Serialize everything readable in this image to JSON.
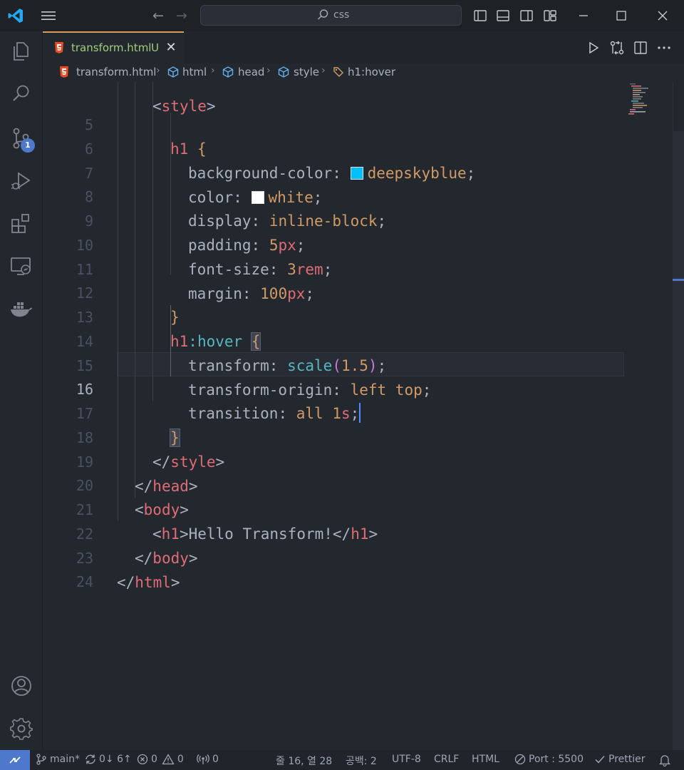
{
  "titlebar": {
    "search_text": "css",
    "nav_back": "←",
    "nav_forward": "→"
  },
  "activity": {
    "scm_badge": "1"
  },
  "tab": {
    "filename": "transform.html",
    "status": "U",
    "close": "✕"
  },
  "breadcrumb": {
    "file": "transform.html",
    "items": [
      "html",
      "head",
      "style",
      "h1:hover"
    ]
  },
  "editor": {
    "line_numbers": [
      "5",
      "6",
      "7",
      "8",
      "9",
      "10",
      "11",
      "12",
      "13",
      "14",
      "15",
      "16",
      "17",
      "18",
      "19",
      "20",
      "21",
      "22",
      "23",
      "24"
    ],
    "active_line": "16",
    "lines": {
      "l5_sel": "h1",
      "l5_brace": "{",
      "l6_prop": "background-color",
      "l6_val": "deepskyblue",
      "l7_prop": "color",
      "l7_val": "white",
      "l8_prop": "display",
      "l8_val": "inline-block",
      "l9_prop": "padding",
      "l9_num": "5",
      "l9_unit": "px",
      "l10_prop": "font-size",
      "l10_num": "3",
      "l10_unit": "rem",
      "l11_prop": "margin",
      "l11_num": "100",
      "l11_unit": "px",
      "l12_brace": "}",
      "l13_sel": "h1",
      "l13_pseudo": ":hover",
      "l13_brace": "{",
      "l14_prop": "transform",
      "l14_fn": "scale",
      "l14_num": "1.5",
      "l15_prop": "transform-origin",
      "l15_val": "left top",
      "l16_prop": "transition",
      "l16_val": "all",
      "l16_num": "1",
      "l16_unit": "s",
      "l17_brace": "}",
      "l18_tag": "style",
      "l19_tag": "head",
      "l20_tag": "body",
      "l21_tag": "h1",
      "l21_text": "Hello Transform!",
      "l22_tag": "body",
      "l23_tag": "html"
    },
    "swatch_colors": {
      "deepskyblue": "#00bfff",
      "white": "#ffffff"
    }
  },
  "statusbar": {
    "branch": "main*",
    "sync": "0↓ 6↑",
    "errors": "0",
    "warnings": "0",
    "ports": "0",
    "position": "줄 16, 열 28",
    "spaces": "공백: 2",
    "encoding": "UTF-8",
    "eol": "CRLF",
    "language": "HTML",
    "port": "Port : 5500",
    "formatter": "Prettier"
  },
  "colors": {
    "accent": "#4d78cc",
    "tab_border": "#d0a05a",
    "modified": "#9fcf7d",
    "html_icon": "#e44d26"
  }
}
